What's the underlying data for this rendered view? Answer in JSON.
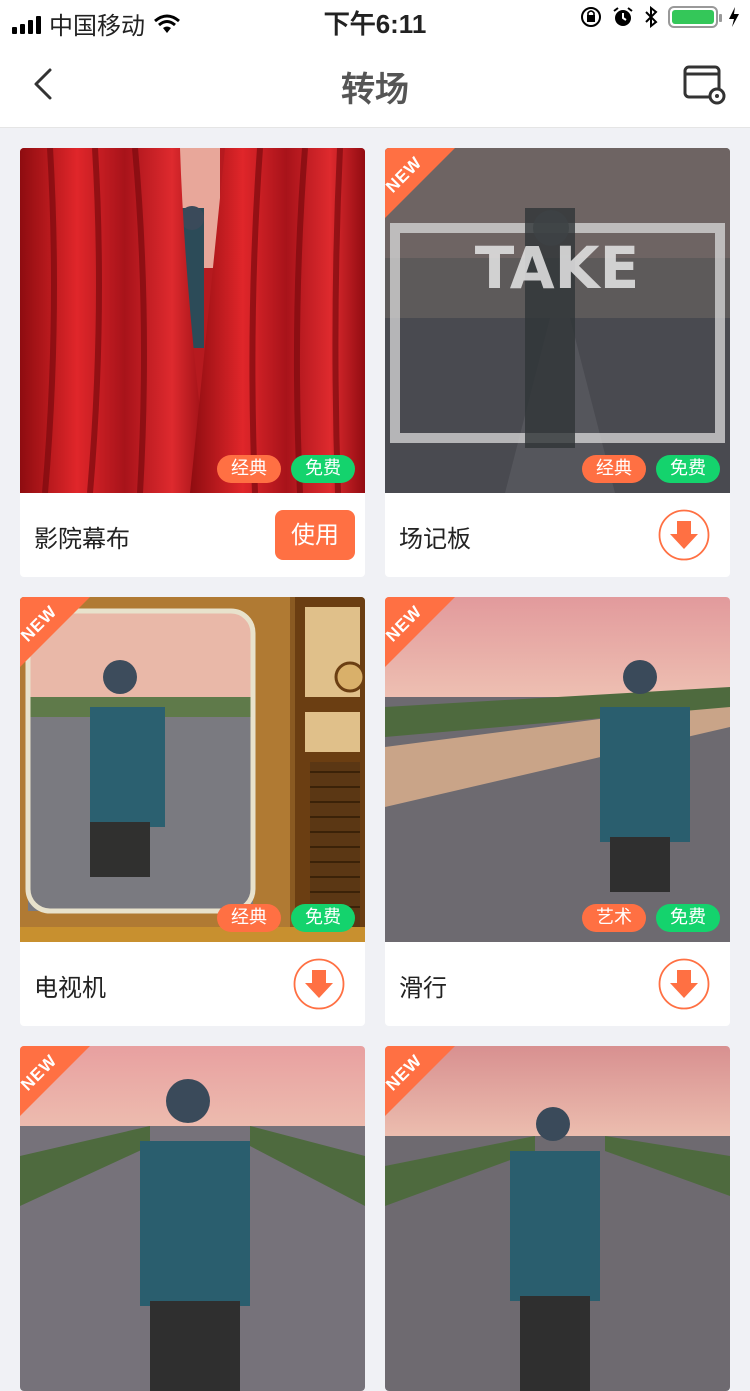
{
  "status_bar": {
    "carrier": "中国移动",
    "time": "下午6:11",
    "icons": [
      "signal-icon",
      "wifi-icon",
      "orientation-lock-icon",
      "alarm-icon",
      "bluetooth-icon",
      "battery-icon",
      "charging-icon"
    ]
  },
  "nav": {
    "title": "转场",
    "back_icon": "chevron-left-icon",
    "settings_icon": "window-settings-icon"
  },
  "colors": {
    "accent": "#ff7043",
    "green": "#14d36d",
    "background": "#f0f1f5"
  },
  "items": [
    {
      "name": "影院幕布",
      "badge_new": "",
      "tags": [
        "经典",
        "免费"
      ],
      "action": "使用"
    },
    {
      "name": "场记板",
      "badge_new": "NEW",
      "tags": [
        "经典",
        "免费"
      ],
      "action": "download",
      "overlay_text": "TAKE"
    },
    {
      "name": "电视机",
      "badge_new": "NEW",
      "tags": [
        "经典",
        "免费"
      ],
      "action": "download"
    },
    {
      "name": "滑行",
      "badge_new": "NEW",
      "tags": [
        "艺术",
        "免费"
      ],
      "action": "download"
    },
    {
      "name": "",
      "badge_new": "NEW",
      "tags": [],
      "action": ""
    },
    {
      "name": "",
      "badge_new": "NEW",
      "tags": [],
      "action": ""
    }
  ]
}
